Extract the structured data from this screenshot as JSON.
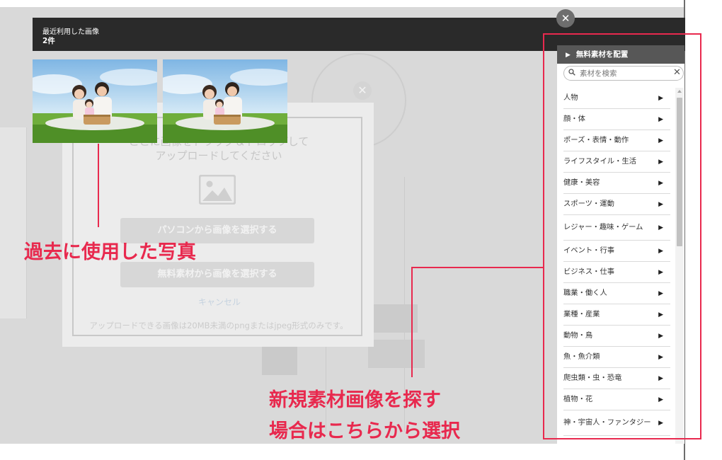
{
  "recent": {
    "title": "最近利用した画像",
    "count": "2件",
    "thumbnails": [
      {
        "icon": "family-picnic-photo"
      },
      {
        "icon": "family-picnic-photo"
      }
    ]
  },
  "close_label": "✕",
  "upload_dialog": {
    "instruction_line1": "ここに画像をドラッグ＆ドロップして",
    "instruction_line2": "アップロードしてください",
    "image_icon": "image-placeholder-icon",
    "pc_button": "パソコンから画像を選択する",
    "free_button": "無料素材から画像を選択する",
    "cancel": "キャンセル",
    "note": "アップロードできる画像は20MB未満のpngまたはjpeg形式のみです。"
  },
  "annotations": {
    "left_callout": "過去に使用した写真",
    "right_callout_line1": "新規素材画像を探す",
    "right_callout_line2": "場合はこちらから選択",
    "accent_color": "#e8294e"
  },
  "sidebar": {
    "header": "無料素材を配置",
    "header_icon": "triangle-right-icon",
    "search_placeholder": "素材を検索",
    "search_clear": "✕",
    "categories": [
      {
        "label": "人物"
      },
      {
        "label": "顔・体"
      },
      {
        "label": "ポーズ・表情・動作"
      },
      {
        "label": "ライフスタイル・生活"
      },
      {
        "label": "健康・美容"
      },
      {
        "label": "スポーツ・運動"
      },
      {
        "label": "レジャー・趣味・ゲーム"
      },
      {
        "label": "イベント・行事"
      },
      {
        "label": "ビジネス・仕事"
      },
      {
        "label": "職業・働く人"
      },
      {
        "label": "業種・産業"
      },
      {
        "label": "動物・鳥"
      },
      {
        "label": "魚・魚介類"
      },
      {
        "label": "爬虫類・虫・恐竜"
      },
      {
        "label": "植物・花"
      },
      {
        "label": "神・宇宙人・ファンタジー"
      }
    ],
    "arrow_glyph": "▶"
  }
}
